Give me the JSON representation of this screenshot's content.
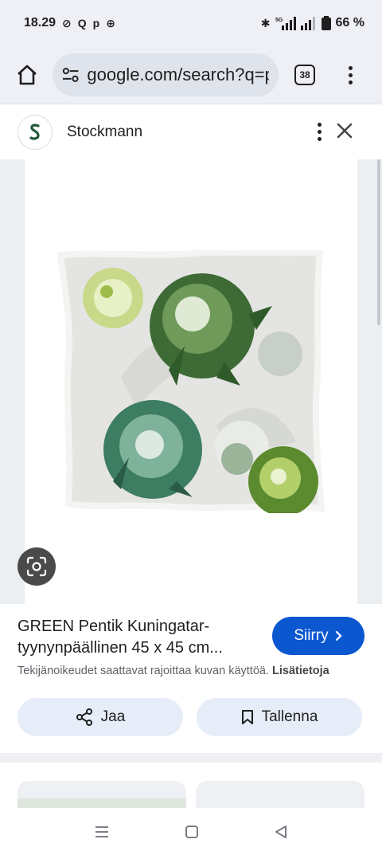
{
  "status_bar": {
    "time": "18.29",
    "left_icons": [
      "check-circle-icon",
      "search-icon",
      "posti-icon",
      "plus-circle-icon"
    ],
    "network": "5G",
    "battery": "66 %"
  },
  "browser": {
    "url": "google.com/search?q=p",
    "tab_count": "38"
  },
  "source": {
    "site_name": "Stockmann"
  },
  "result": {
    "title": "GREEN Pentik Kuningatar-tyynynpäällinen 45 x 45 cm...",
    "goto_label": "Siirry",
    "copyright": "Tekijänoikeudet saattavat rajoittaa kuvan käyttöä.",
    "more_info": "Lisätietoja",
    "share_label": "Jaa",
    "save_label": "Tallenna"
  },
  "colors": {
    "accent": "#0b57d0",
    "chip_bg": "#e6edf8",
    "header_bg": "#eef0f6",
    "logo_green": "#1e5a3a"
  }
}
